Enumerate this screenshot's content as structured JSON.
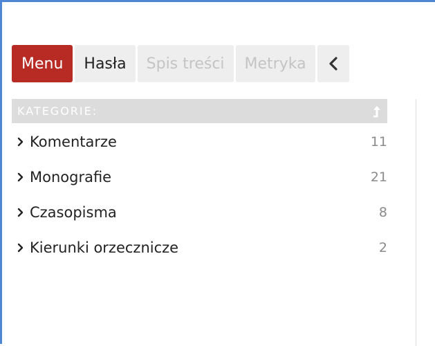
{
  "tabs": [
    {
      "label": "Menu",
      "state": "active"
    },
    {
      "label": "Hasła",
      "state": "enabled"
    },
    {
      "label": "Spis treści",
      "state": "disabled"
    },
    {
      "label": "Metryka",
      "state": "disabled"
    }
  ],
  "collapse_icon": "chevron-left-icon",
  "categories": {
    "header": "KATEGORIE:",
    "header_icon": "arrow-up-icon",
    "items": [
      {
        "label": "Komentarze",
        "count": "11"
      },
      {
        "label": "Monografie",
        "count": "21"
      },
      {
        "label": "Czasopisma",
        "count": "8"
      },
      {
        "label": "Kierunki orzecznicze",
        "count": "2"
      }
    ]
  },
  "colors": {
    "active_tab": "#b82b25",
    "frame_border": "#4f86d6",
    "header_bg": "#dcdcdc"
  }
}
